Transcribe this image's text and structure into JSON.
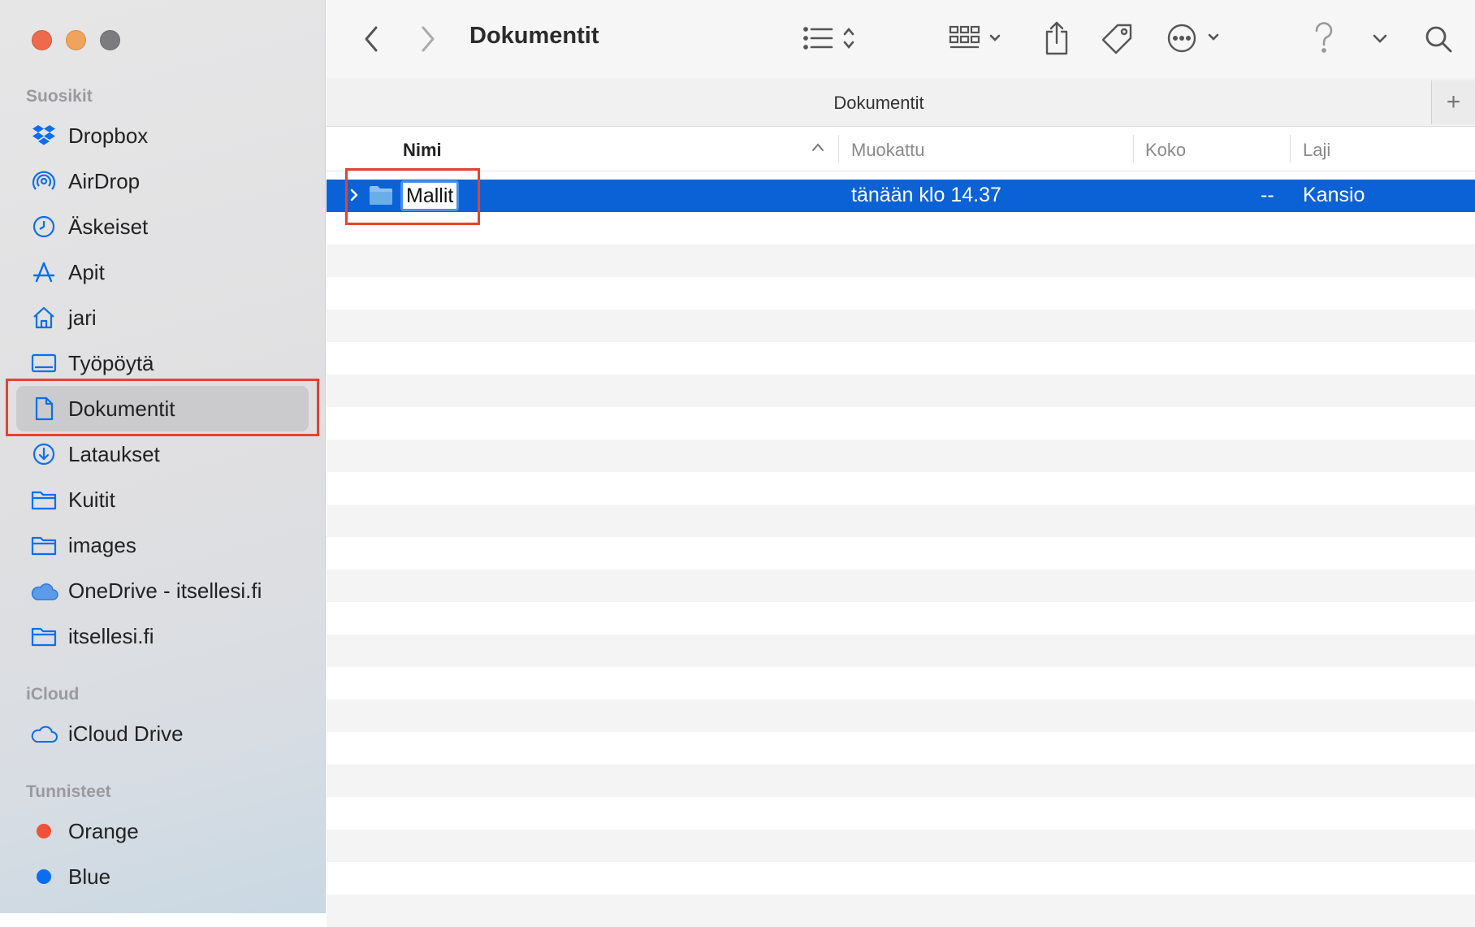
{
  "window": {
    "title": "Dokumentit"
  },
  "colors": {
    "accent": "#0b62d6",
    "highlight": "#e5432f",
    "tag_orange": "#f05138",
    "tag_blue": "#0a6ef0"
  },
  "sidebar": {
    "favorites_heading": "Suosikit",
    "favorites": [
      {
        "label": "Dropbox",
        "icon": "dropbox-icon"
      },
      {
        "label": "AirDrop",
        "icon": "airdrop-icon"
      },
      {
        "label": "Äskeiset",
        "icon": "clock-icon"
      },
      {
        "label": "Apit",
        "icon": "apps-icon"
      },
      {
        "label": "jari",
        "icon": "home-icon"
      },
      {
        "label": "Työpöytä",
        "icon": "desktop-icon"
      },
      {
        "label": "Dokumentit",
        "icon": "document-icon"
      },
      {
        "label": "Lataukset",
        "icon": "download-icon"
      },
      {
        "label": "Kuitit",
        "icon": "folder-icon"
      },
      {
        "label": "images",
        "icon": "folder-icon"
      },
      {
        "label": "OneDrive - itsellesi.fi",
        "icon": "cloud-icon"
      },
      {
        "label": "itsellesi.fi",
        "icon": "folder-icon"
      }
    ],
    "icloud_heading": "iCloud",
    "icloud": [
      {
        "label": "iCloud Drive",
        "icon": "icloud-icon"
      }
    ],
    "tags_heading": "Tunnisteet",
    "tags": [
      {
        "label": "Orange"
      },
      {
        "label": "Blue"
      }
    ]
  },
  "tab": {
    "title": "Dokumentit",
    "plus": "+"
  },
  "columns": {
    "name": "Nimi",
    "modified": "Muokattu",
    "size": "Koko",
    "kind": "Laji"
  },
  "files": [
    {
      "name": "Mallit",
      "modified": "tänään klo 14.37",
      "size": "--",
      "kind": "Kansio"
    }
  ]
}
